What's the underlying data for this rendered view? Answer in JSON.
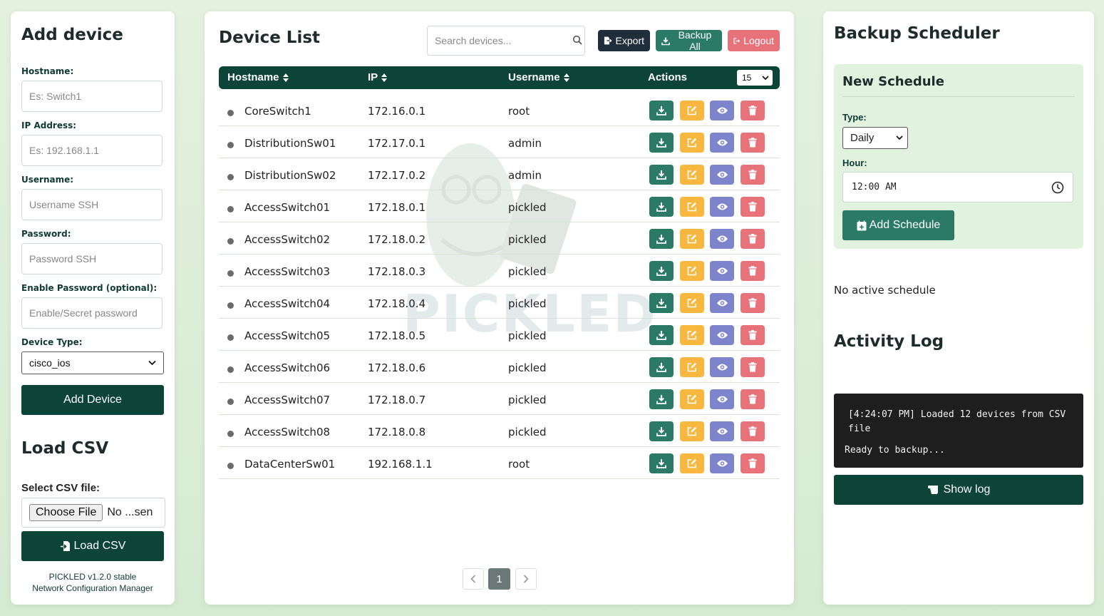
{
  "add_device": {
    "title": "Add device",
    "hostname_label": "Hostname:",
    "hostname_placeholder": "Es: Switch1",
    "ip_label": "IP Address:",
    "ip_placeholder": "Es: 192.168.1.1",
    "username_label": "Username:",
    "username_placeholder": "Username SSH",
    "password_label": "Password:",
    "password_placeholder": "Password SSH",
    "enable_label": "Enable Password (optional):",
    "enable_placeholder": "Enable/Secret password",
    "device_type_label": "Device Type:",
    "device_type_value": "cisco_ios",
    "add_button": "Add Device"
  },
  "load_csv": {
    "title": "Load CSV",
    "select_label": "Select CSV file:",
    "choose_file": "Choose File",
    "no_file": "No ...sen",
    "load_button": "Load CSV"
  },
  "footer": {
    "version": "PICKLED v1.2.0 stable",
    "subtitle": "Network Configuration Manager"
  },
  "device_list": {
    "title": "Device List",
    "search_placeholder": "Search devices...",
    "export": "Export",
    "backup_all": "Backup All",
    "logout": "Logout",
    "columns": [
      "Hostname",
      "IP",
      "Username",
      "Actions"
    ],
    "page_size": "15",
    "rows": [
      {
        "hostname": "CoreSwitch1",
        "ip": "172.16.0.1",
        "username": "root"
      },
      {
        "hostname": "DistributionSw01",
        "ip": "172.17.0.1",
        "username": "admin"
      },
      {
        "hostname": "DistributionSw02",
        "ip": "172.17.0.2",
        "username": "admin"
      },
      {
        "hostname": "AccessSwitch01",
        "ip": "172.18.0.1",
        "username": "pickled"
      },
      {
        "hostname": "AccessSwitch02",
        "ip": "172.18.0.2",
        "username": "pickled"
      },
      {
        "hostname": "AccessSwitch03",
        "ip": "172.18.0.3",
        "username": "pickled"
      },
      {
        "hostname": "AccessSwitch04",
        "ip": "172.18.0.4",
        "username": "pickled"
      },
      {
        "hostname": "AccessSwitch05",
        "ip": "172.18.0.5",
        "username": "pickled"
      },
      {
        "hostname": "AccessSwitch06",
        "ip": "172.18.0.6",
        "username": "pickled"
      },
      {
        "hostname": "AccessSwitch07",
        "ip": "172.18.0.7",
        "username": "pickled"
      },
      {
        "hostname": "AccessSwitch08",
        "ip": "172.18.0.8",
        "username": "pickled"
      },
      {
        "hostname": "DataCenterSw01",
        "ip": "192.168.1.1",
        "username": "root"
      }
    ],
    "current_page": "1",
    "watermark_text": "PICKLED"
  },
  "scheduler": {
    "title": "Backup Scheduler",
    "new_schedule": "New Schedule",
    "type_label": "Type:",
    "type_value": "Daily",
    "hour_label": "Hour:",
    "hour_value": "12:00 AM",
    "add_button": "Add Schedule",
    "no_active": "No active schedule"
  },
  "activity": {
    "title": "Activity Log",
    "line1": "[4:24:07 PM] Loaded 12 devices from CSV file",
    "line2": "Ready to backup...",
    "show_log": "Show log"
  },
  "colors": {
    "primary_dark": "#0c4438",
    "primary": "#2a7a66",
    "warning": "#f8b840",
    "info": "#7d84cc",
    "danger": "#e8727a",
    "background": "#d9ecd6"
  }
}
